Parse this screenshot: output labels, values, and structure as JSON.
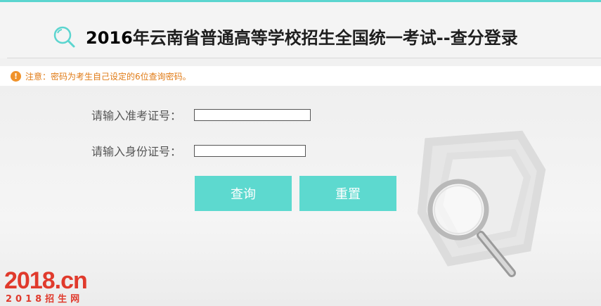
{
  "header": {
    "year": "2016",
    "title_rest": "年云南省普通高等学校招生全国统一考试--查分登录",
    "logo_icon": "search-bubble-icon"
  },
  "notice": {
    "icon": "exclamation-icon",
    "text": "注意：密码为考生自己设定的6位查询密码。"
  },
  "form": {
    "exam_number_label": "请输入准考证号：",
    "exam_number_value": "",
    "id_number_label": "请输入身份证号：",
    "id_number_value": ""
  },
  "buttons": {
    "query_label": "查询",
    "reset_label": "重置"
  },
  "brand": {
    "main": "2018.cn",
    "sub": "2018招生网"
  },
  "colors": {
    "accent": "#5dd9cf",
    "notice": "#e07b16",
    "brand": "#e03a2c"
  }
}
